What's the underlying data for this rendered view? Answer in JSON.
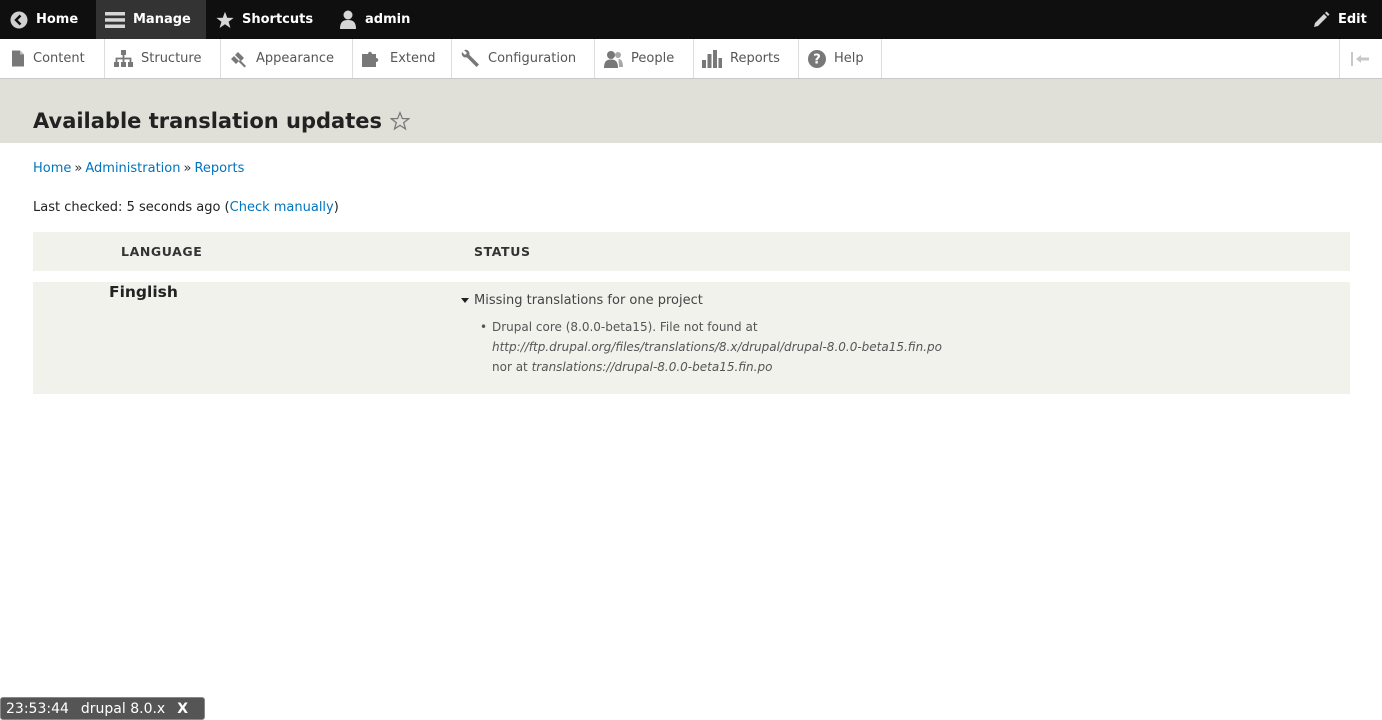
{
  "toolbar": {
    "home_label": "Home",
    "manage_label": "Manage",
    "shortcuts_label": "Shortcuts",
    "user_label": "admin",
    "edit_label": "Edit"
  },
  "tray": {
    "items": [
      {
        "label": "Content",
        "icon": "page-icon"
      },
      {
        "label": "Structure",
        "icon": "structure-icon"
      },
      {
        "label": "Appearance",
        "icon": "brush-icon"
      },
      {
        "label": "Extend",
        "icon": "puzzle-icon"
      },
      {
        "label": "Configuration",
        "icon": "wrench-icon"
      },
      {
        "label": "People",
        "icon": "people-icon"
      },
      {
        "label": "Reports",
        "icon": "bar-chart-icon"
      },
      {
        "label": "Help",
        "icon": "help-icon"
      }
    ]
  },
  "page": {
    "title": "Available translation updates"
  },
  "breadcrumb": {
    "items": [
      "Home",
      "Administration",
      "Reports"
    ],
    "separator": "»"
  },
  "last_checked": {
    "prefix": "Last checked: 5 seconds ago (",
    "link": "Check manually",
    "suffix": ")"
  },
  "table": {
    "headers": [
      "LANGUAGE",
      "STATUS"
    ],
    "rows": [
      {
        "language": "Finglish",
        "summary": "Missing translations for one project",
        "detail_prefix": "Drupal core (8.0.0-beta15). File not found at ",
        "detail_url1": "http://ftp.drupal.org/files/translations/8.x/drupal/drupal-8.0.0-beta15.fin.po",
        "detail_mid": " nor at ",
        "detail_url2": "translations://drupal-8.0.0-beta15.fin.po"
      }
    ]
  },
  "overlay": {
    "time": "23:53:44",
    "title": "drupal 8.0.x",
    "close": "X"
  },
  "colors": {
    "link": "#0074bd",
    "toolbar_bg": "#0f0f0f",
    "header_bg": "#e0e0d8",
    "table_bg": "#f2f2ed"
  }
}
